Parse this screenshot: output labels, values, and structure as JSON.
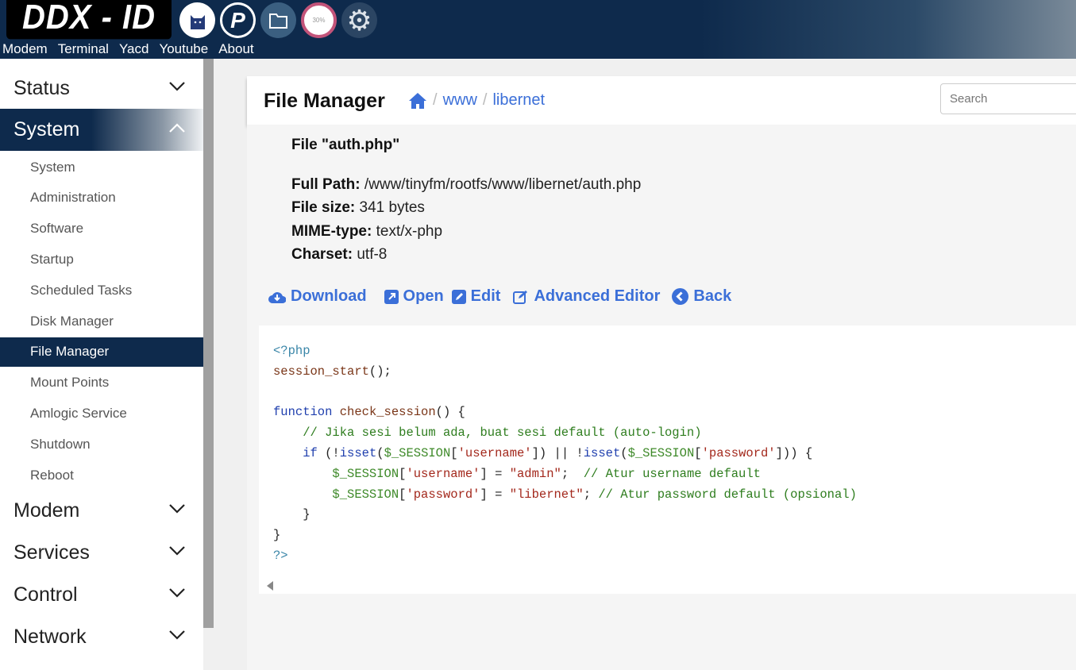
{
  "header": {
    "logo": "DDX - ID",
    "nav": [
      "Modem",
      "Terminal",
      "Yacd",
      "Youtube",
      "About"
    ],
    "icons": [
      "cat-icon",
      "p-logo-icon",
      "folder-icon",
      "gauge-icon",
      "gear-icon"
    ]
  },
  "sidebar": {
    "menus": [
      {
        "label": "Status",
        "open": false
      },
      {
        "label": "System",
        "open": true
      },
      {
        "label": "Modem",
        "open": false
      },
      {
        "label": "Services",
        "open": false
      },
      {
        "label": "Control",
        "open": false
      },
      {
        "label": "Network",
        "open": false
      }
    ],
    "system_items": [
      "System",
      "Administration",
      "Software",
      "Startup",
      "Scheduled Tasks",
      "Disk Manager",
      "File Manager",
      "Mount Points",
      "Amlogic Service",
      "Shutdown",
      "Reboot"
    ],
    "active_item": "File Manager"
  },
  "panel": {
    "title": "File Manager",
    "breadcrumb": [
      "www",
      "libernet"
    ],
    "search_placeholder": "Search"
  },
  "file": {
    "heading": "File \"auth.php\"",
    "full_path_label": "Full Path:",
    "full_path": "/www/tinyfm/rootfs/www/libernet/auth.php",
    "size_label": "File size:",
    "size": "341 bytes",
    "mime_label": "MIME-type:",
    "mime": "text/x-php",
    "charset_label": "Charset:",
    "charset": "utf-8"
  },
  "actions": {
    "download": "Download",
    "open": "Open",
    "edit": "Edit",
    "advanced_editor": "Advanced Editor",
    "back": "Back"
  },
  "colors": {
    "accent": "#3b6fd8",
    "navy": "#0e2a4c"
  },
  "code": [
    [
      [
        "tag",
        "<?php"
      ]
    ],
    [
      [
        "fn",
        "session_start"
      ],
      [
        "pl",
        "();"
      ]
    ],
    [],
    [
      [
        "kw",
        "function"
      ],
      [
        "pl",
        " "
      ],
      [
        "fn",
        "check_session"
      ],
      [
        "pl",
        "() {"
      ]
    ],
    [
      [
        "pl",
        "    "
      ],
      [
        "cm",
        "// Jika sesi belum ada, buat sesi default (auto-login)"
      ]
    ],
    [
      [
        "pl",
        "    "
      ],
      [
        "kw",
        "if"
      ],
      [
        "pl",
        " (!"
      ],
      [
        "kw",
        "isset"
      ],
      [
        "pl",
        "("
      ],
      [
        "var",
        "$_SESSION"
      ],
      [
        "pl",
        "["
      ],
      [
        "str",
        "'username'"
      ],
      [
        "pl",
        "]) || !"
      ],
      [
        "kw",
        "isset"
      ],
      [
        "pl",
        "("
      ],
      [
        "var",
        "$_SESSION"
      ],
      [
        "pl",
        "["
      ],
      [
        "str",
        "'password'"
      ],
      [
        "pl",
        "])) {"
      ]
    ],
    [
      [
        "pl",
        "        "
      ],
      [
        "var",
        "$_SESSION"
      ],
      [
        "pl",
        "["
      ],
      [
        "str",
        "'username'"
      ],
      [
        "pl",
        "] = "
      ],
      [
        "str",
        "\"admin\""
      ],
      [
        "pl",
        ";  "
      ],
      [
        "cm",
        "// Atur username default"
      ]
    ],
    [
      [
        "pl",
        "        "
      ],
      [
        "var",
        "$_SESSION"
      ],
      [
        "pl",
        "["
      ],
      [
        "str",
        "'password'"
      ],
      [
        "pl",
        "] = "
      ],
      [
        "str",
        "\"libernet\""
      ],
      [
        "pl",
        "; "
      ],
      [
        "cm",
        "// Atur password default (opsional)"
      ]
    ],
    [
      [
        "pl",
        "    }"
      ]
    ],
    [
      [
        "pl",
        "}"
      ]
    ],
    [
      [
        "tag",
        "?>"
      ]
    ]
  ]
}
